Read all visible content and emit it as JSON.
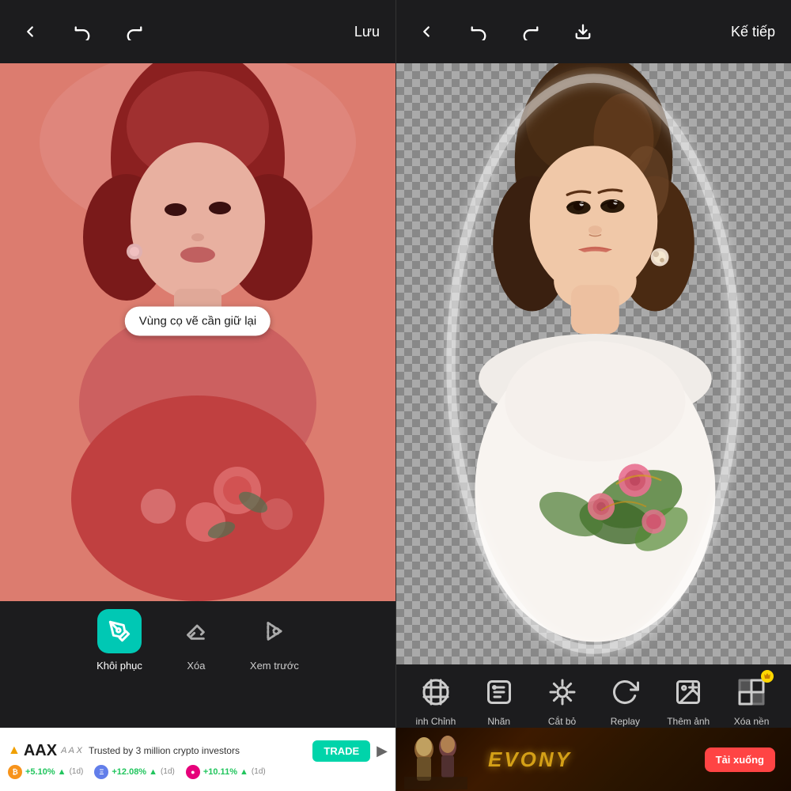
{
  "left": {
    "toolbar": {
      "back_icon": "←",
      "undo_icon": "↩",
      "redo_icon": "↪",
      "save_label": "Lưu"
    },
    "tooltip": "Vùng cọ vẽ cần giữ lại",
    "tools": [
      {
        "id": "restore",
        "label": "Khôi phục",
        "active": true,
        "icon": "✏️"
      },
      {
        "id": "erase",
        "label": "Xóa",
        "active": false,
        "icon": "◻"
      },
      {
        "id": "preview",
        "label": "Xem trước",
        "active": false,
        "icon": "◈"
      }
    ]
  },
  "right": {
    "toolbar": {
      "back_icon": "←",
      "undo_icon": "↩",
      "redo_icon": "↪",
      "download_icon": "⬇",
      "next_label": "Kế tiếp"
    },
    "tools": [
      {
        "id": "crop",
        "label": "Chỉnh",
        "icon": "crop"
      },
      {
        "id": "label",
        "label": "Nhãn",
        "icon": "label"
      },
      {
        "id": "cutout",
        "label": "Cắt bỏ",
        "icon": "cutout"
      },
      {
        "id": "replay",
        "label": "Replay",
        "icon": "replay"
      },
      {
        "id": "add_photo",
        "label": "Thêm ảnh",
        "icon": "add_photo"
      },
      {
        "id": "remove_bg",
        "label": "Xóa nền",
        "icon": "remove_bg"
      }
    ]
  },
  "ad": {
    "logo": "AAX",
    "logo_symbol": "▲",
    "tagline": "Trusted by 3 million crypto investors",
    "trade_label": "TRADE",
    "arrow": "▶",
    "cryptos": [
      {
        "symbol": "BTC",
        "price": "+5.10%",
        "period": "(1d)"
      },
      {
        "symbol": "ETH",
        "price": "+12.08%",
        "period": "(1d)"
      },
      {
        "symbol": "DOT",
        "price": "+10.11%",
        "period": "(1d)"
      }
    ]
  },
  "evony_ad": {
    "title": "EVONY",
    "download_label": "Tải xuống"
  }
}
